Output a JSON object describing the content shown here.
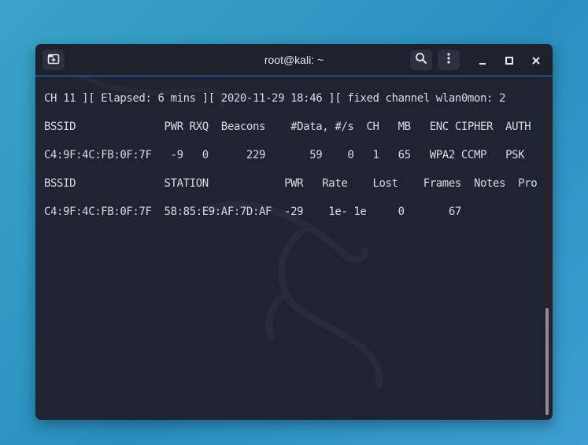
{
  "window": {
    "title": "root@kali: ~"
  },
  "terminal": {
    "lines": [
      "CH 11 ][ Elapsed: 6 mins ][ 2020-11-29 18:46 ][ fixed channel wlan0mon: 2",
      "BSSID              PWR RXQ  Beacons    #Data, #/s  CH   MB   ENC CIPHER  AUTH",
      "C4:9F:4C:FB:0F:7F   -9   0      229       59    0   1   65   WPA2 CCMP   PSK",
      "BSSID              STATION            PWR   Rate    Lost    Frames  Notes  Pro",
      "C4:9F:4C:FB:0F:7F  58:85:E9:AF:7D:AF  -29    1e- 1e     0       67"
    ]
  },
  "colors": {
    "accent": "#2f7bd4",
    "background": "#1f2430",
    "text": "#d8dbe0"
  },
  "icons": {
    "new_tab": "new-tab-icon",
    "search": "search-icon",
    "menu": "kebab-menu-icon",
    "minimize": "minimize-icon",
    "maximize": "maximize-icon",
    "close": "close-icon"
  }
}
